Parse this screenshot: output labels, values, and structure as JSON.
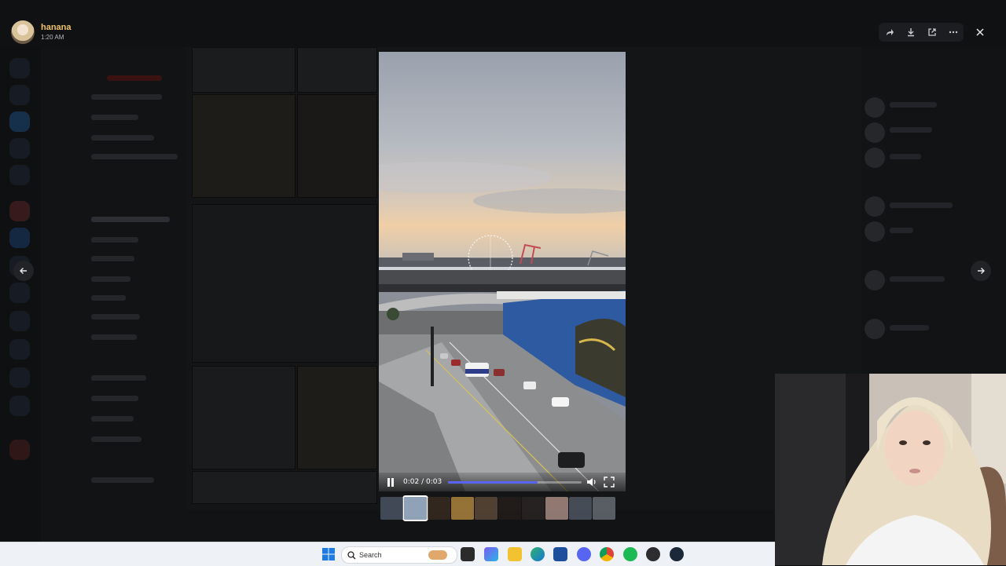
{
  "viewer": {
    "uploader_name": "hanana",
    "upload_time": "1:20 AM"
  },
  "player": {
    "time_display": "0:02 / 0:03",
    "progress": 0.67,
    "state": "playing"
  },
  "thumbnails": {
    "count": 10,
    "selected_index": 1,
    "colors": [
      "#4d5666",
      "#8fa2b8",
      "#3a2c20",
      "#b5893e",
      "#5e4b3a",
      "#241d1a",
      "#2b2624",
      "#b0928a",
      "#525a66",
      "#6a6f78"
    ]
  },
  "taskbar": {
    "search_placeholder": "Search"
  },
  "colors": {
    "accent": "#5865f2",
    "username": "#f0c46b"
  }
}
